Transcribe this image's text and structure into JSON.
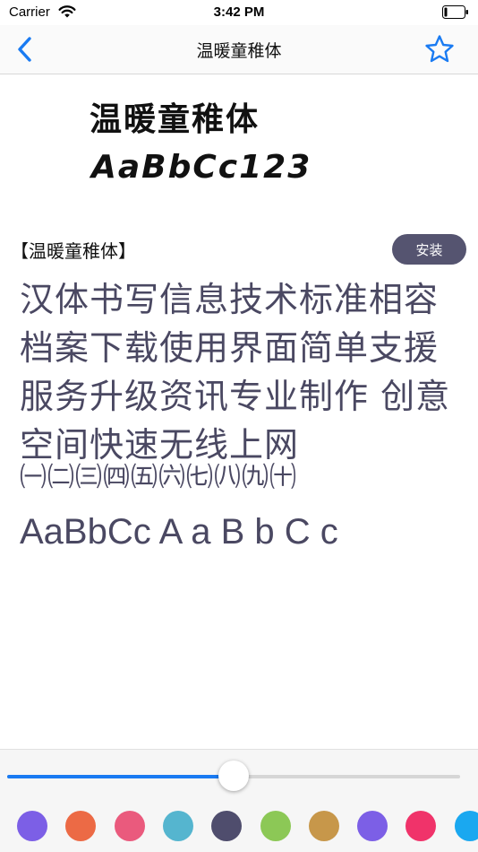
{
  "status_bar": {
    "carrier": "Carrier",
    "time": "3:42 PM"
  },
  "nav": {
    "title": "温暖童稚体",
    "back_icon": "chevron-left-icon",
    "favorite_icon": "star-outline-icon",
    "accent": "#1a7bf2"
  },
  "preview": {
    "line1": "温暖童稚体",
    "line2": "AaBbCc123"
  },
  "font_name": "【温暖童稚体】",
  "install_label": "安装",
  "sample": {
    "chinese": "汉体书写信息技术标准相容 档案下载使用界面简单支援服务升级资讯专业制作 创意空间快速无线上网",
    "numerals": "㈠㈡㈢㈣㈤㈥㈦㈧㈨㈩",
    "latin": "AaBbCc A a B b C c",
    "text_color": "#4a4862"
  },
  "slider": {
    "value": 0.5
  },
  "color_swatches": [
    "#7c5fe6",
    "#ec6a45",
    "#ea5a7d",
    "#55b5cf",
    "#4f4d6d",
    "#8cc856",
    "#c7974a",
    "#7c5fe6",
    "#f0336a",
    "#1aa8f0"
  ]
}
